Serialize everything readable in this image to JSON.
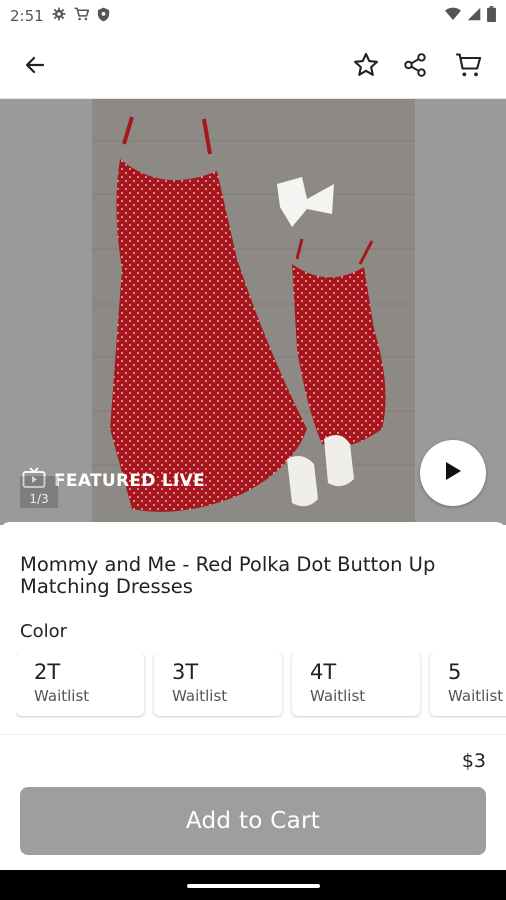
{
  "status_bar": {
    "time": "2:51",
    "left_icons": [
      "gear-icon",
      "cart-icon",
      "shield-icon"
    ],
    "right_icons": [
      "wifi-icon",
      "signal-icon",
      "battery-icon"
    ]
  },
  "app_bar": {
    "icons": [
      "back-arrow-icon",
      "star-icon",
      "share-icon",
      "cart-icon"
    ]
  },
  "hero": {
    "live_label": "FEATURED LIVE",
    "image_counter": "1/3",
    "play_icon": "play-icon"
  },
  "product": {
    "title": "Mommy and Me - Red Polka Dot Button Up Matching Dresses",
    "color_label": "Color",
    "sizes": [
      {
        "name": "2T",
        "status": "Waitlist"
      },
      {
        "name": "3T",
        "status": "Waitlist"
      },
      {
        "name": "4T",
        "status": "Waitlist"
      },
      {
        "name": "5",
        "status": "Waitlist"
      }
    ],
    "price": "$3",
    "add_to_cart_label": "Add to Cart"
  },
  "colors": {
    "dress_red": "#a8161d",
    "button_disabled": "#9e9e9e",
    "hero_bg": "#9a9a9a"
  }
}
